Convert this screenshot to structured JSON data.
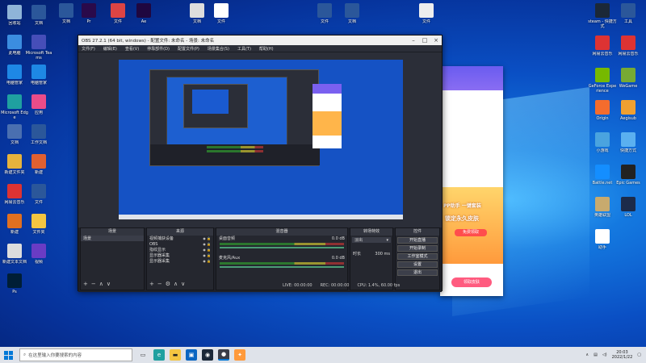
{
  "desktop": {
    "left_icons": [
      {
        "label": "回收站",
        "color": "#8fb4d8"
      },
      {
        "label": "此电脑",
        "color": "#3b8de0"
      },
      {
        "label": "电脑管家",
        "color": "#1e88e5"
      },
      {
        "label": "Microsoft Edge",
        "color": "#1fa0a0"
      },
      {
        "label": "文档",
        "color": "#4a6fb0"
      },
      {
        "label": "新建文件夹",
        "color": "#e6b33d"
      },
      {
        "label": "网易云音乐",
        "color": "#d33"
      },
      {
        "label": "新建",
        "color": "#e07020"
      },
      {
        "label": "新建文本文档",
        "color": "#ddd"
      },
      {
        "label": "Ps",
        "color": "#001e36"
      }
    ],
    "left_icons_col2": [
      {
        "label": "文档",
        "color": "#2b579a"
      },
      {
        "label": "Microsoft Teams",
        "color": "#464eb8"
      },
      {
        "label": "电脑管家",
        "color": "#1e88e5"
      },
      {
        "label": "应用",
        "color": "#ea4c89"
      },
      {
        "label": "工作文档",
        "color": "#2b579a"
      },
      {
        "label": "新建",
        "color": "#e06030"
      },
      {
        "label": "文件",
        "color": "#2b579a"
      },
      {
        "label": "文件夹",
        "color": "#f4c542"
      },
      {
        "label": "视频",
        "color": "#6a3cc4"
      }
    ],
    "top_icons": [
      {
        "label": "文档",
        "color": "#2b579a"
      },
      {
        "label": "Pr",
        "color": "#2a0a4a"
      },
      {
        "label": "文件",
        "color": "#d44"
      },
      {
        "label": "Ae",
        "color": "#1f0740"
      },
      {
        "label": "文档",
        "color": "#ddd"
      },
      {
        "label": "文件",
        "color": "#fff"
      },
      {
        "label": "文件",
        "color": "#2b579a"
      },
      {
        "label": "文档",
        "color": "#2b579a"
      },
      {
        "label": "文件",
        "color": "#eee"
      }
    ],
    "right_icons": [
      {
        "label": "steam - 快捷方式",
        "color": "#1b2838"
      },
      {
        "label": "工具",
        "color": "#2b579a"
      },
      {
        "label": "网易云音乐",
        "color": "#d33"
      },
      {
        "label": "网易云音乐",
        "color": "#d33"
      },
      {
        "label": "GeForce Experience",
        "color": "#76b900"
      },
      {
        "label": "WeGame",
        "color": "#7a3"
      },
      {
        "label": "Origin",
        "color": "#f56c2d"
      },
      {
        "label": "Aegisub",
        "color": "#f0a030"
      },
      {
        "label": "小游戏",
        "color": "#4aa3df"
      },
      {
        "label": "快捷方式",
        "color": "#5ab0f0"
      },
      {
        "label": "Battle.net",
        "color": "#148eff"
      },
      {
        "label": "Epic Games",
        "color": "#222"
      },
      {
        "label": "英雄联盟",
        "color": "#c8aa6e"
      },
      {
        "label": "LOL",
        "color": "#1c2b4a"
      },
      {
        "label": "助手",
        "color": "#fff"
      }
    ]
  },
  "obs": {
    "title": "OBS 27.2.1 (64 bit, windows) - 配置文件: 未命名 - 场景: 未命名",
    "menu": [
      "文件(F)",
      "编辑(E)",
      "查看(V)",
      "停靠部件(D)",
      "配置文件(P)",
      "场景集合(S)",
      "工具(T)",
      "帮助(H)"
    ],
    "docks": {
      "scenes": {
        "title": "场景",
        "items": [
          "场景"
        ]
      },
      "sources": {
        "title": "来源",
        "items": [
          "视频捕获设备",
          "OBS",
          "指纹显示",
          "显示器采集",
          "显示器采集"
        ]
      },
      "mixer": {
        "title": "混音器",
        "tracks": [
          {
            "name": "桌面音频",
            "db": "0.0 dB"
          },
          {
            "name": "麦克风/Aux",
            "db": "0.0 dB"
          }
        ]
      },
      "transitions": {
        "title": "转场特效",
        "type": "淡出",
        "duration_label": "时长",
        "duration": "300 ms"
      },
      "controls": {
        "title": "控件",
        "buttons": [
          "开始直播",
          "开始录制",
          "工作室模式",
          "设置",
          "退出"
        ]
      }
    },
    "status": {
      "live": "LIVE: 00:00:00",
      "rec": "REC: 00:00:00",
      "cpu": "CPU: 1.4%, 60.00 fps"
    }
  },
  "popup": {
    "banner_text": "PP助手 一键套装",
    "subtitle": "锁定永久皮肤",
    "cta": "免费领取",
    "bottom_button": "领取皮肤"
  },
  "taskbar": {
    "search_placeholder": "在这里输入你要搜索的内容",
    "time": "20:03",
    "date": "2022/1/22"
  }
}
